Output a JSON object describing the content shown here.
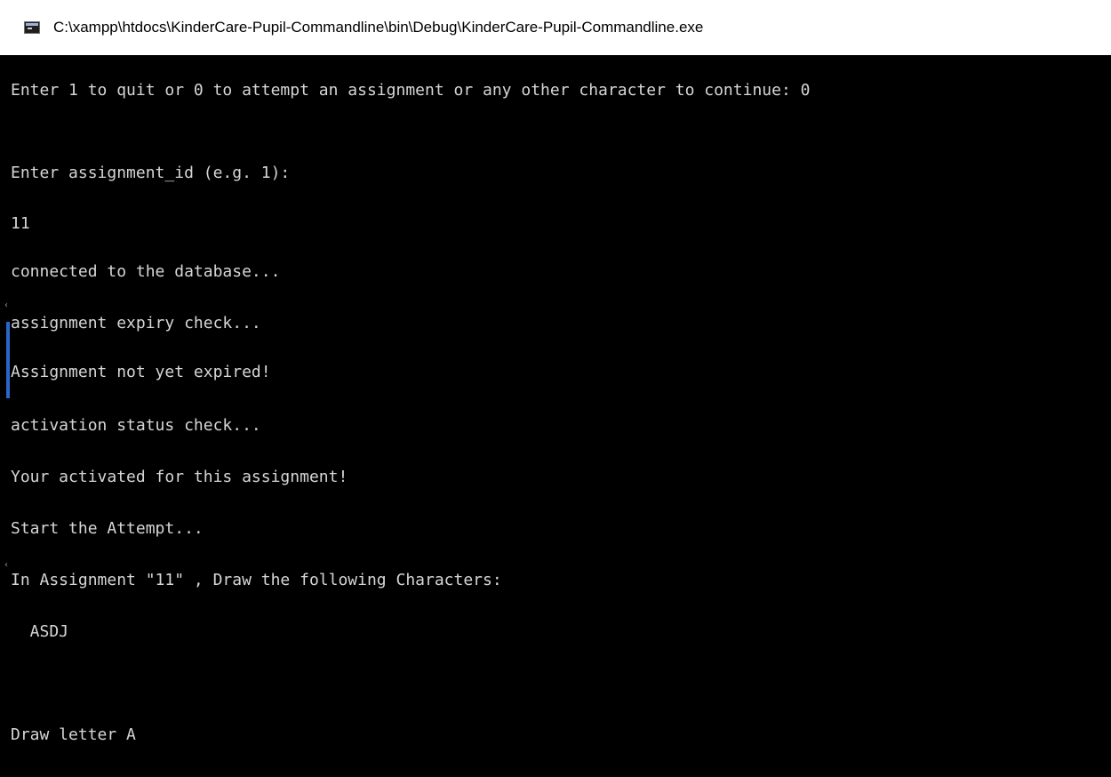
{
  "window": {
    "title": "C:\\xampp\\htdocs\\KinderCare-Pupil-Commandline\\bin\\Debug\\KinderCare-Pupil-Commandline.exe",
    "icon": "console-app-icon"
  },
  "console": {
    "lines": [
      "Enter 1 to quit or 0 to attempt an assignment or any other character to continue: 0",
      "Enter assignment_id (e.g. 1):",
      "11",
      "connected to the database...",
      "assignment expiry check...",
      "Assignment not yet expired!",
      "activation status check...",
      "Your activated for this assignment!",
      "Start the Attempt...",
      "In Assignment \"11\" , Draw the following Characters:",
      "  ASDJ",
      "Draw letter A"
    ],
    "text_color": "#d6d6d6",
    "background_color": "#000000"
  }
}
